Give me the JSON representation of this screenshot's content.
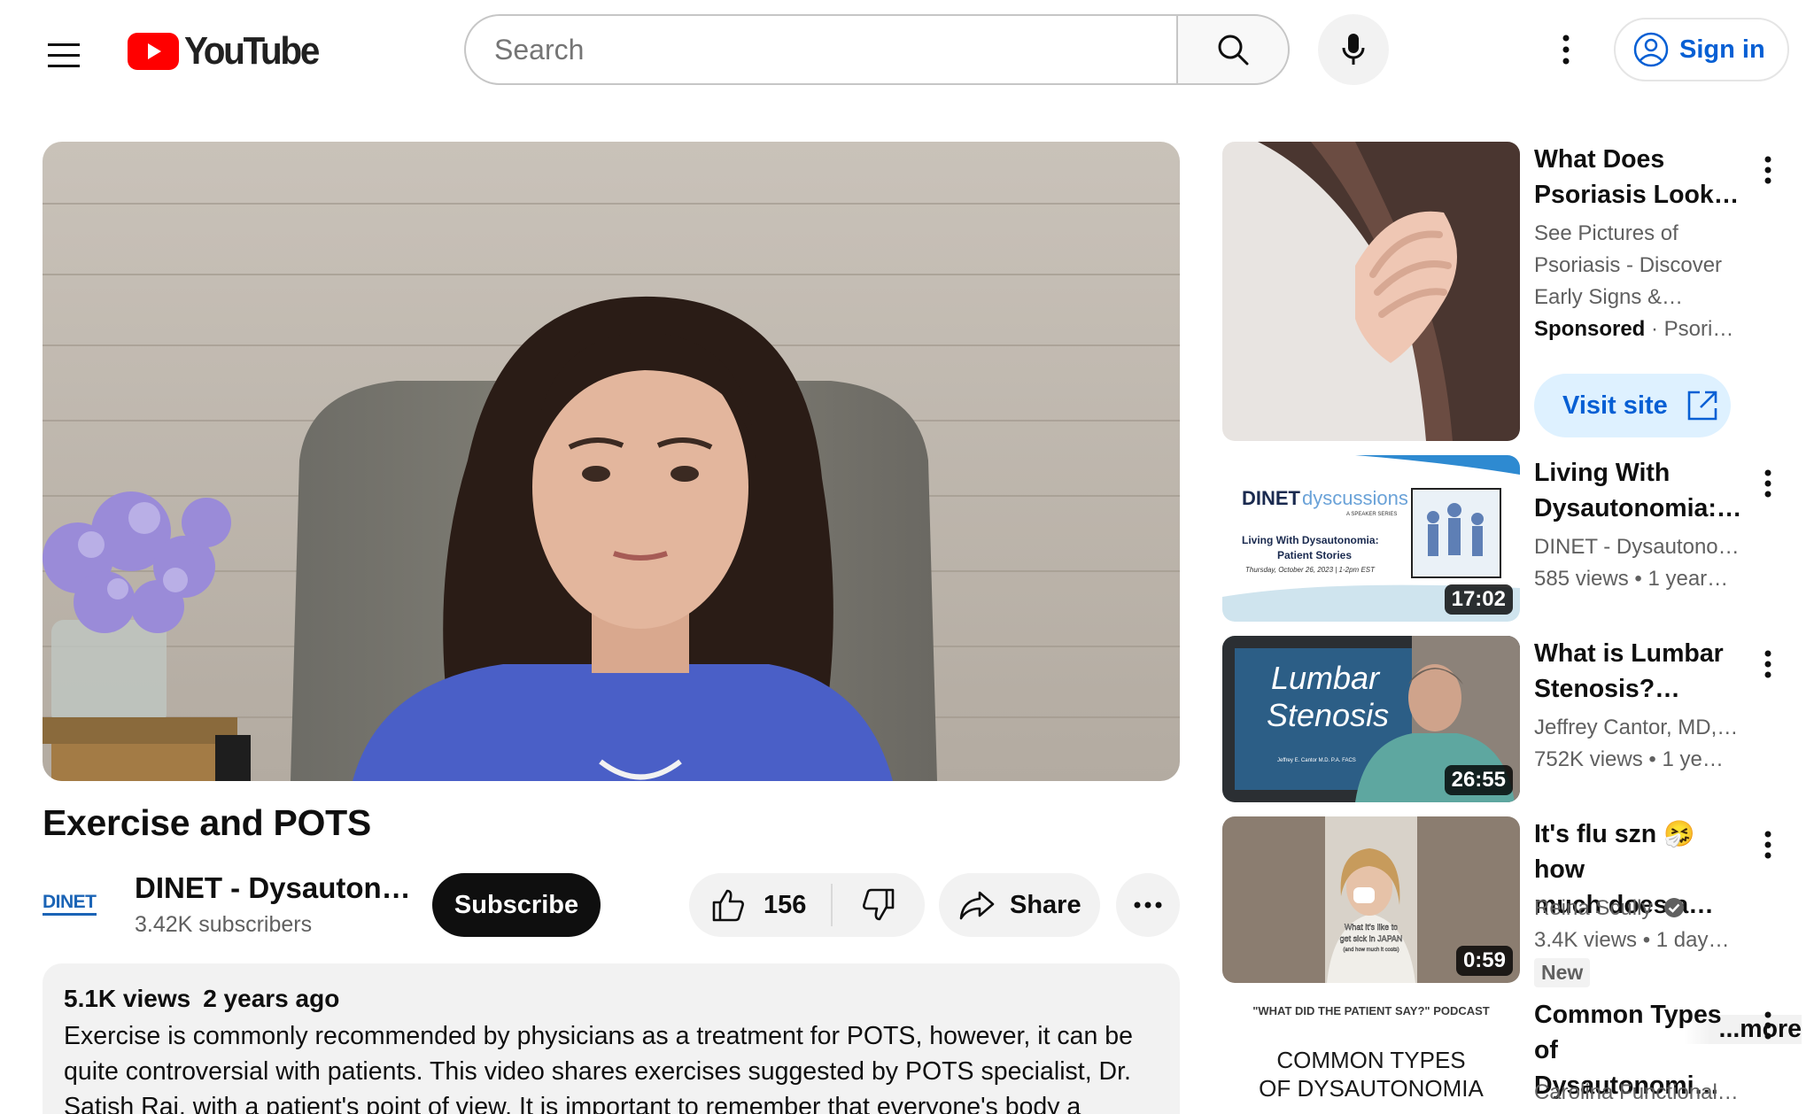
{
  "masthead": {
    "logo_text": "YouTube",
    "search_placeholder": "Search",
    "sign_in_label": "Sign in"
  },
  "video": {
    "title": "Exercise and POTS",
    "channel": {
      "avatar_text": "DINET",
      "name": "DINET - Dysauton…",
      "subscribers": "3.42K subscribers"
    },
    "subscribe_label": "Subscribe",
    "likes": "156",
    "share_label": "Share",
    "description": {
      "views": "5.1K views",
      "age": "2 years ago",
      "text": "Exercise is commonly recommended by physicians as a treatment for POTS, however, it can be quite controversial with patients. This video shares exercises suggested by POTS specialist, Dr. Satish Raj, with a patient's point of view. It is important to remember that everyone's body a",
      "more_label": "...more"
    }
  },
  "recommendations": [
    {
      "title_line1": "What Does",
      "title_line2": "Psoriasis Look…",
      "meta1": "See Pictures of",
      "meta2": "Psoriasis - Discover",
      "meta3": "Early Signs &…",
      "sponsored_label": "Sponsored",
      "advertiser": "Psoria…",
      "visit_site_label": "Visit site"
    },
    {
      "title_line1": "Living With",
      "title_line2": "Dysautonomia:…",
      "channel": "DINET - Dysautono…",
      "stats": "585 views  • 1 year…",
      "duration": "17:02",
      "thumb_brand": "DINET",
      "thumb_brand2": "dyscussions",
      "thumb_series": "A SPEAKER SERIES",
      "thumb_line1": "Living With Dysautonomia:",
      "thumb_line2": "Patient Stories",
      "thumb_date": "Thursday, October 26, 2023 | 1-2pm EST"
    },
    {
      "title_line1": "What is Lumbar",
      "title_line2": "Stenosis?…",
      "channel": "Jeffrey Cantor, MD, …",
      "stats": "752K views  • 1 ye…",
      "duration": "26:55",
      "thumb_line1": "Lumbar",
      "thumb_line2": "Stenosis",
      "thumb_credit": "Jeffrey E. Cantor M.D. P.A. FACS"
    },
    {
      "title_line1": "It's flu szn 🤧 how",
      "title_line2": "much does a…",
      "channel": "Reina Scully",
      "stats": "3.4K views  • 1 day…",
      "badge": "New",
      "duration": "0:59",
      "thumb_caption1": "What it's like to",
      "thumb_caption2": "get sick in JAPAN",
      "thumb_caption3": "(and how much it costs)"
    },
    {
      "title_line1": "Common Types",
      "title_line2": "of Dysautonomi…",
      "channel": "Carolina Functional…",
      "thumb_podcast": "\"WHAT DID THE PATIENT SAY?\" PODCAST",
      "thumb_line1": "COMMON TYPES",
      "thumb_line2": "OF DYSAUTONOMIA"
    }
  ],
  "colors": {
    "brand_red": "#ff0000",
    "link_blue": "#065fd4",
    "pill_bg": "#f2f2f2"
  }
}
